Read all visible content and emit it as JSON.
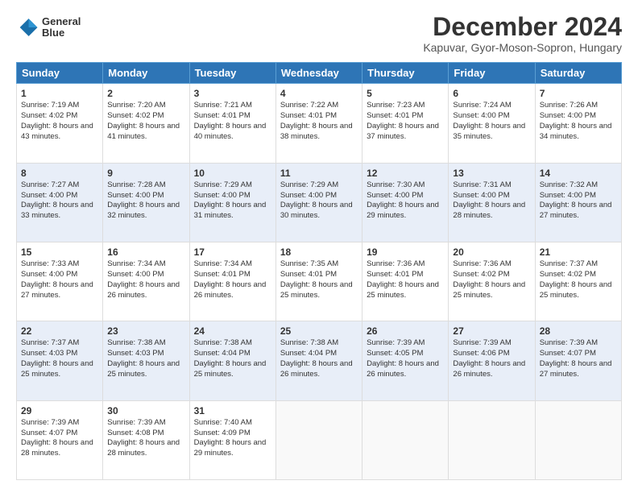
{
  "header": {
    "logo": {
      "line1": "General",
      "line2": "Blue"
    },
    "title": "December 2024",
    "subtitle": "Kapuvar, Gyor-Moson-Sopron, Hungary"
  },
  "days_of_week": [
    "Sunday",
    "Monday",
    "Tuesday",
    "Wednesday",
    "Thursday",
    "Friday",
    "Saturday"
  ],
  "weeks": [
    [
      {
        "day": 1,
        "sunrise": "7:19 AM",
        "sunset": "4:02 PM",
        "daylight": "8 hours and 43 minutes."
      },
      {
        "day": 2,
        "sunrise": "7:20 AM",
        "sunset": "4:02 PM",
        "daylight": "8 hours and 41 minutes."
      },
      {
        "day": 3,
        "sunrise": "7:21 AM",
        "sunset": "4:01 PM",
        "daylight": "8 hours and 40 minutes."
      },
      {
        "day": 4,
        "sunrise": "7:22 AM",
        "sunset": "4:01 PM",
        "daylight": "8 hours and 38 minutes."
      },
      {
        "day": 5,
        "sunrise": "7:23 AM",
        "sunset": "4:01 PM",
        "daylight": "8 hours and 37 minutes."
      },
      {
        "day": 6,
        "sunrise": "7:24 AM",
        "sunset": "4:00 PM",
        "daylight": "8 hours and 35 minutes."
      },
      {
        "day": 7,
        "sunrise": "7:26 AM",
        "sunset": "4:00 PM",
        "daylight": "8 hours and 34 minutes."
      }
    ],
    [
      {
        "day": 8,
        "sunrise": "7:27 AM",
        "sunset": "4:00 PM",
        "daylight": "8 hours and 33 minutes."
      },
      {
        "day": 9,
        "sunrise": "7:28 AM",
        "sunset": "4:00 PM",
        "daylight": "8 hours and 32 minutes."
      },
      {
        "day": 10,
        "sunrise": "7:29 AM",
        "sunset": "4:00 PM",
        "daylight": "8 hours and 31 minutes."
      },
      {
        "day": 11,
        "sunrise": "7:29 AM",
        "sunset": "4:00 PM",
        "daylight": "8 hours and 30 minutes."
      },
      {
        "day": 12,
        "sunrise": "7:30 AM",
        "sunset": "4:00 PM",
        "daylight": "8 hours and 29 minutes."
      },
      {
        "day": 13,
        "sunrise": "7:31 AM",
        "sunset": "4:00 PM",
        "daylight": "8 hours and 28 minutes."
      },
      {
        "day": 14,
        "sunrise": "7:32 AM",
        "sunset": "4:00 PM",
        "daylight": "8 hours and 27 minutes."
      }
    ],
    [
      {
        "day": 15,
        "sunrise": "7:33 AM",
        "sunset": "4:00 PM",
        "daylight": "8 hours and 27 minutes."
      },
      {
        "day": 16,
        "sunrise": "7:34 AM",
        "sunset": "4:00 PM",
        "daylight": "8 hours and 26 minutes."
      },
      {
        "day": 17,
        "sunrise": "7:34 AM",
        "sunset": "4:01 PM",
        "daylight": "8 hours and 26 minutes."
      },
      {
        "day": 18,
        "sunrise": "7:35 AM",
        "sunset": "4:01 PM",
        "daylight": "8 hours and 25 minutes."
      },
      {
        "day": 19,
        "sunrise": "7:36 AM",
        "sunset": "4:01 PM",
        "daylight": "8 hours and 25 minutes."
      },
      {
        "day": 20,
        "sunrise": "7:36 AM",
        "sunset": "4:02 PM",
        "daylight": "8 hours and 25 minutes."
      },
      {
        "day": 21,
        "sunrise": "7:37 AM",
        "sunset": "4:02 PM",
        "daylight": "8 hours and 25 minutes."
      }
    ],
    [
      {
        "day": 22,
        "sunrise": "7:37 AM",
        "sunset": "4:03 PM",
        "daylight": "8 hours and 25 minutes."
      },
      {
        "day": 23,
        "sunrise": "7:38 AM",
        "sunset": "4:03 PM",
        "daylight": "8 hours and 25 minutes."
      },
      {
        "day": 24,
        "sunrise": "7:38 AM",
        "sunset": "4:04 PM",
        "daylight": "8 hours and 25 minutes."
      },
      {
        "day": 25,
        "sunrise": "7:38 AM",
        "sunset": "4:04 PM",
        "daylight": "8 hours and 26 minutes."
      },
      {
        "day": 26,
        "sunrise": "7:39 AM",
        "sunset": "4:05 PM",
        "daylight": "8 hours and 26 minutes."
      },
      {
        "day": 27,
        "sunrise": "7:39 AM",
        "sunset": "4:06 PM",
        "daylight": "8 hours and 26 minutes."
      },
      {
        "day": 28,
        "sunrise": "7:39 AM",
        "sunset": "4:07 PM",
        "daylight": "8 hours and 27 minutes."
      }
    ],
    [
      {
        "day": 29,
        "sunrise": "7:39 AM",
        "sunset": "4:07 PM",
        "daylight": "8 hours and 28 minutes."
      },
      {
        "day": 30,
        "sunrise": "7:39 AM",
        "sunset": "4:08 PM",
        "daylight": "8 hours and 28 minutes."
      },
      {
        "day": 31,
        "sunrise": "7:40 AM",
        "sunset": "4:09 PM",
        "daylight": "8 hours and 29 minutes."
      },
      null,
      null,
      null,
      null
    ]
  ]
}
